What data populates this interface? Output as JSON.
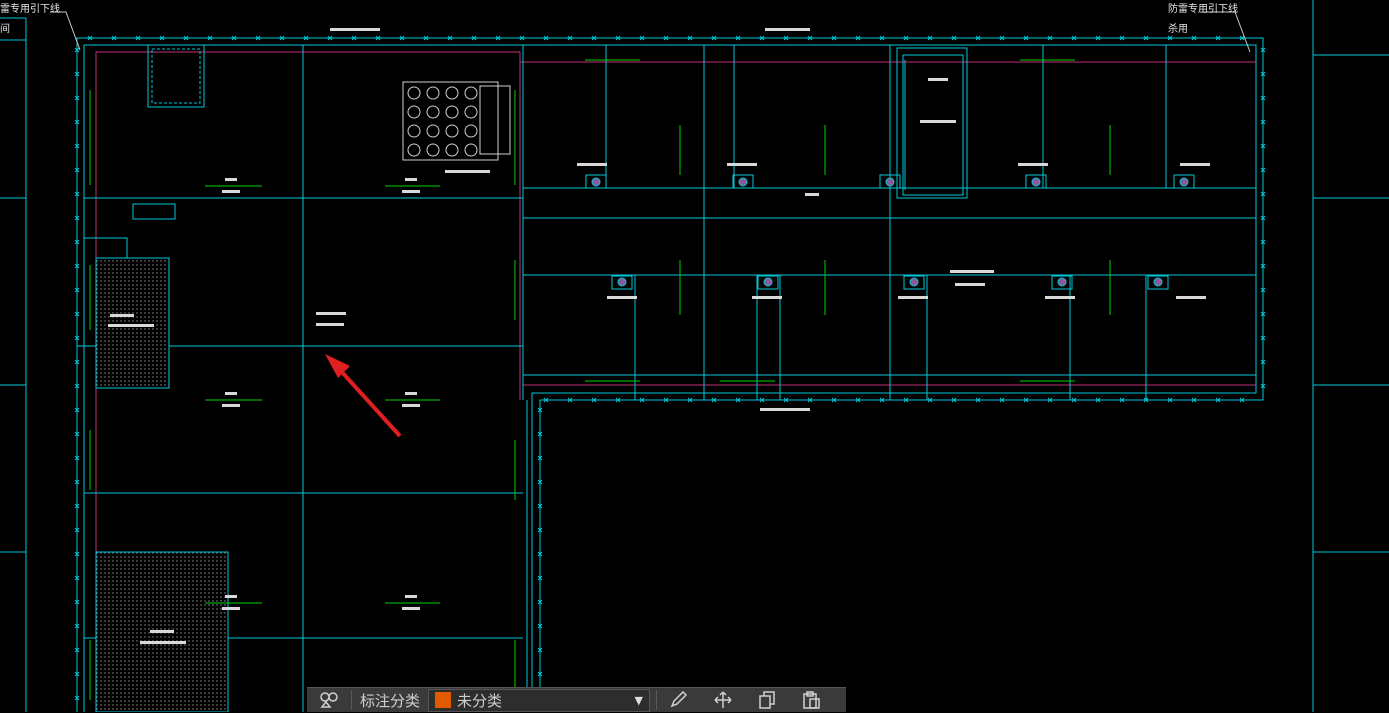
{
  "drawing": {
    "note_top_left": "雷专用引下线",
    "note_top_left_2": "间",
    "note_top_right": "防雷专用引下线",
    "note_top_right_2": "杀用"
  },
  "toolbar": {
    "label": "标注分类",
    "category_value": "未分类",
    "category_color": "#e05a00",
    "buttons": [
      "group-icon",
      "edit-icon",
      "move-icon",
      "copy-icon",
      "paste-icon"
    ]
  },
  "colors": {
    "wall": "#00c8d8",
    "beam": "#c0307a",
    "arrow": "#00d000",
    "annotation": "#e02020"
  }
}
